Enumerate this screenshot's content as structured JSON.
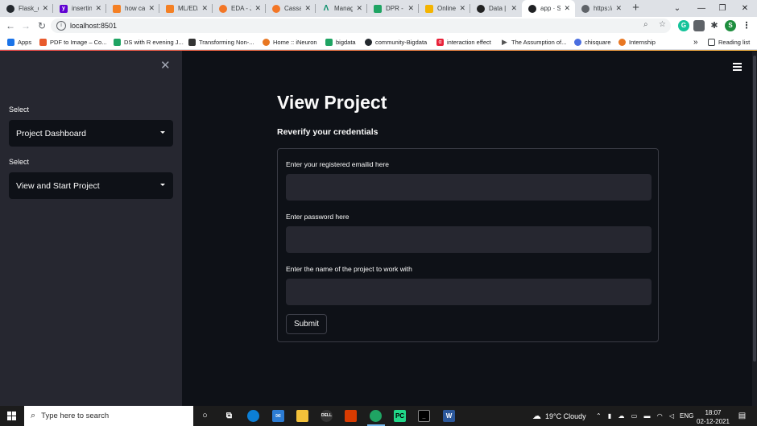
{
  "browser": {
    "tabs": [
      {
        "title": "Flask_c",
        "favicon": "github-icon",
        "color": "#24292e"
      },
      {
        "title": "insertin",
        "favicon": "yahoo-icon",
        "color": "#6001d2"
      },
      {
        "title": "how ca",
        "favicon": "stackoverflow-icon",
        "color": "#f48024"
      },
      {
        "title": "ML/ED/",
        "favicon": "stackoverflow-icon",
        "color": "#f48024"
      },
      {
        "title": "EDA - J",
        "favicon": "jupyter-icon",
        "color": "#f37626"
      },
      {
        "title": "Cassan",
        "favicon": "jupyter-icon",
        "color": "#f37626"
      },
      {
        "title": "Manag",
        "favicon": "manage-icon",
        "color": "#0a8f6a"
      },
      {
        "title": "DPR - C",
        "favicon": "drive-icon",
        "color": "#1fa463"
      },
      {
        "title": "Online",
        "favicon": "online-icon",
        "color": "#f4b400"
      },
      {
        "title": "Data | C",
        "favicon": "data-icon",
        "color": "#222222"
      },
      {
        "title": "app · St",
        "favicon": "streamlit-icon",
        "color": "#ff4b4b"
      },
      {
        "title": "https://",
        "favicon": "globe-icon",
        "color": "#5f6368"
      }
    ],
    "url": "localhost:8501",
    "bookmarks": [
      {
        "label": "Apps",
        "icon": "apps-icon",
        "color": "#1a73e8"
      },
      {
        "label": "PDF to Image – Co...",
        "icon": "pdf-icon",
        "color": "#e85a2c"
      },
      {
        "label": "DS with R evening J...",
        "icon": "drive-icon",
        "color": "#1fa463"
      },
      {
        "label": "Transforming Non-...",
        "icon": "page-icon",
        "color": "#333333"
      },
      {
        "label": "Home :: iNeuron",
        "icon": "ineuron-icon",
        "color": "#e87722"
      },
      {
        "label": "bigdata",
        "icon": "drive-icon",
        "color": "#1fa463"
      },
      {
        "label": "community-Bigdata",
        "icon": "github-icon",
        "color": "#24292e"
      },
      {
        "label": "interaction effect",
        "icon": "alpha-icon",
        "color": "#e8233a"
      },
      {
        "label": "The Assumption of...",
        "icon": "play-icon",
        "color": "#555555"
      },
      {
        "label": "chisquare",
        "icon": "chisquare-icon",
        "color": "#4a6ee0"
      },
      {
        "label": "Internship",
        "icon": "internship-icon",
        "color": "#e87722"
      }
    ],
    "more_bookmarks": "»",
    "reading_list": "Reading list",
    "profile_initial": "S"
  },
  "sidebar": {
    "select1_label": "Select",
    "select1_value": "Project Dashboard",
    "select2_label": "Select",
    "select2_value": "View and Start Project"
  },
  "main": {
    "title": "View Project",
    "subtitle": "Reverify your credentials",
    "form": {
      "email_label": "Enter your registered emailid here",
      "password_label": "Enter password here",
      "project_label": "Enter the name of the project to work with",
      "submit_label": "Submit"
    }
  },
  "taskbar": {
    "search_placeholder": "Type here to search",
    "weather": "19°C  Cloudy",
    "language": "ENG",
    "time": "18:07",
    "date": "02-12-2021"
  }
}
